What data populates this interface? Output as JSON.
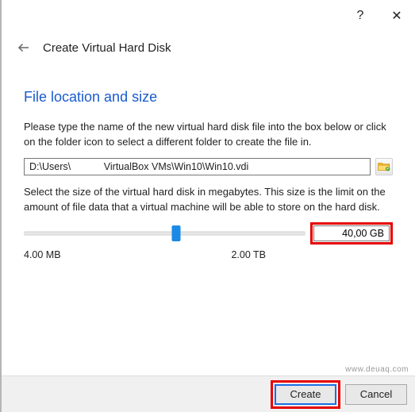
{
  "titlebar": {
    "help": "?",
    "close": "✕"
  },
  "header": {
    "title": "Create Virtual Hard Disk"
  },
  "section": {
    "title": "File location and size"
  },
  "text": {
    "path_help": "Please type the name of the new virtual hard disk file into the box below or click on the folder icon to select a different folder to create the file in.",
    "size_help": "Select the size of the virtual hard disk in megabytes. This size is the limit on the amount of file data that a virtual machine will be able to store on the hard disk."
  },
  "path": {
    "value": "D:\\Users\\            VirtualBox VMs\\Win10\\Win10.vdi"
  },
  "slider": {
    "min_label": "4.00 MB",
    "max_label": "2.00 TB",
    "thumb_percent": 54,
    "size_value": "40,00 GB"
  },
  "footer": {
    "create": "Create",
    "cancel": "Cancel"
  },
  "watermark": "www.deuaq.com"
}
